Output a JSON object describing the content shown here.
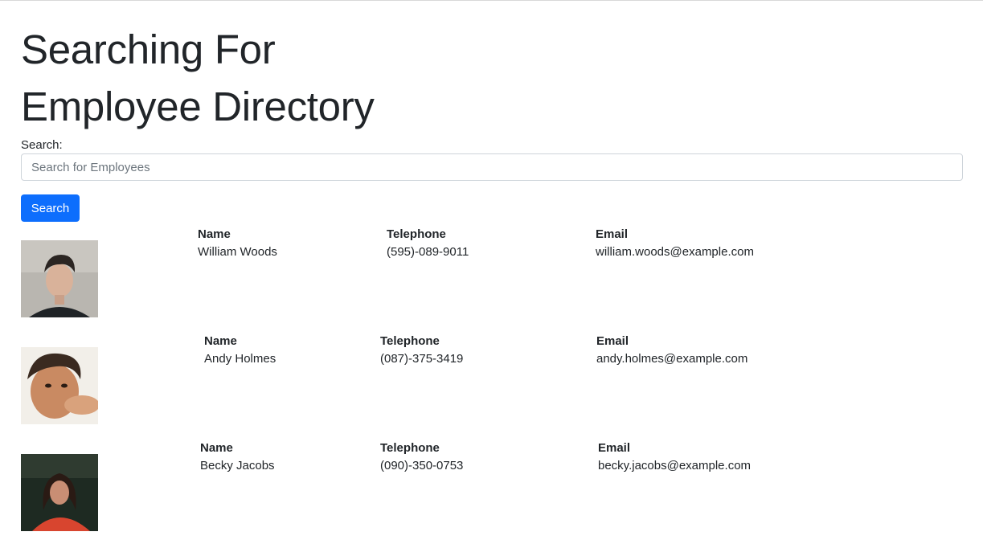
{
  "page": {
    "title_line1": "Searching For",
    "title_line2": "Employee Directory"
  },
  "search": {
    "label": "Search:",
    "placeholder": "Search for Employees",
    "value": "",
    "button_label": "Search"
  },
  "columns": {
    "name": "Name",
    "telephone": "Telephone",
    "email": "Email"
  },
  "employees": [
    {
      "name": "William Woods",
      "telephone": "(595)-089-9011",
      "email": "william.woods@example.com"
    },
    {
      "name": "Andy Holmes",
      "telephone": "(087)-375-3419",
      "email": "andy.holmes@example.com"
    },
    {
      "name": "Becky Jacobs",
      "telephone": "(090)-350-0753",
      "email": "becky.jacobs@example.com"
    }
  ],
  "colors": {
    "primary": "#0d6efd",
    "text": "#212529",
    "input_border": "#ced4da"
  }
}
